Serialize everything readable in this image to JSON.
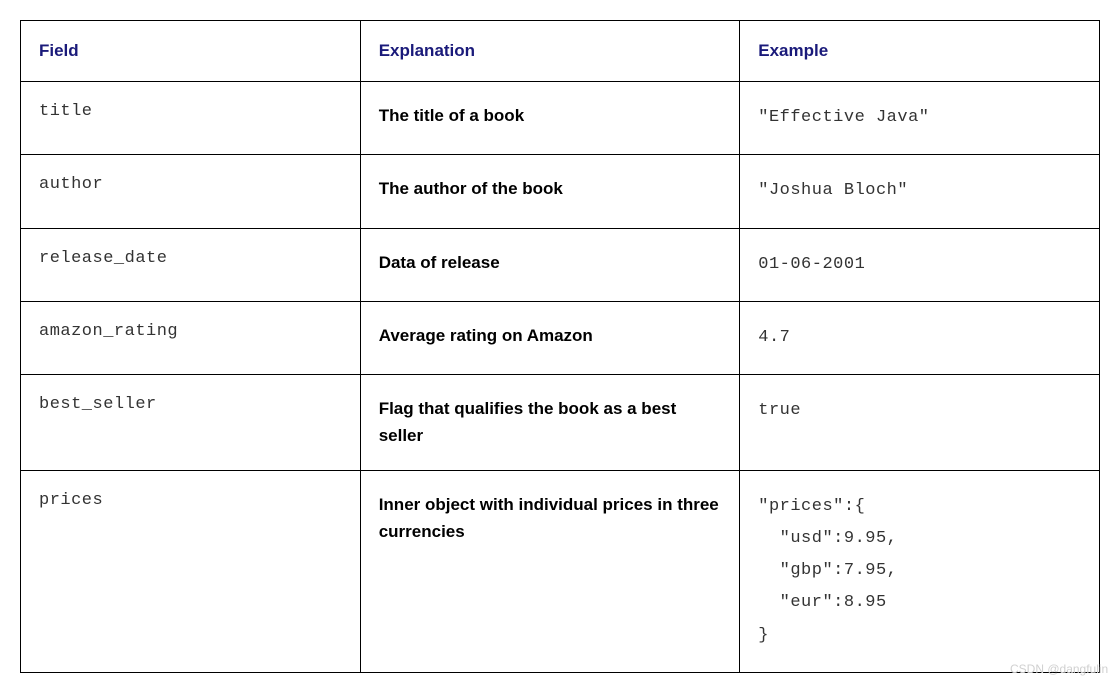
{
  "headers": {
    "field": "Field",
    "explanation": "Explanation",
    "example": "Example"
  },
  "rows": [
    {
      "field": "title",
      "explanation": "The title of a book",
      "example": "\"Effective Java\""
    },
    {
      "field": "author",
      "explanation": "The author of the book",
      "example": "\"Joshua Bloch\""
    },
    {
      "field": "release_date",
      "explanation": "Data of release",
      "example": "01-06-2001"
    },
    {
      "field": "amazon_rating",
      "explanation": "Average rating on Amazon",
      "example": "4.7"
    },
    {
      "field": "best_seller",
      "explanation": "Flag that qualifies the book as a best seller",
      "example": "true"
    },
    {
      "field": "prices",
      "explanation": "Inner object with individual prices in three currencies",
      "example": "\"prices\":{\n  \"usd\":9.95,\n  \"gbp\":7.95,\n  \"eur\":8.95\n}"
    }
  ],
  "watermark": "CSDN @dangfulin"
}
